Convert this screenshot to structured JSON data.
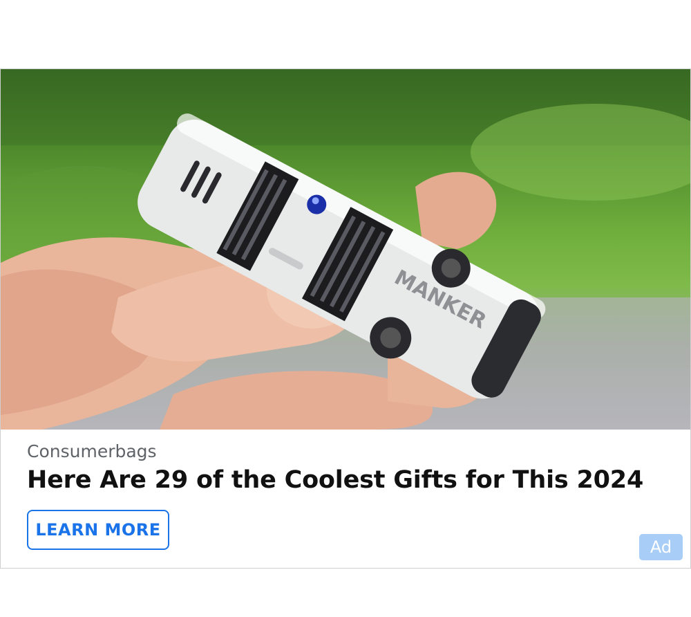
{
  "ad": {
    "image_description_icon": "product-photo",
    "product_brand_mark": "MANKER",
    "advertiser": "Consumerbags",
    "headline": "Here Are 29 of the Coolest Gifts for This 2024",
    "cta_label": "LEARN MORE",
    "badge": "Ad",
    "colors": {
      "accent": "#1a73e8",
      "badge_bg": "#a8cdf7",
      "headline": "#111111",
      "advertiser": "#5f6368"
    }
  }
}
